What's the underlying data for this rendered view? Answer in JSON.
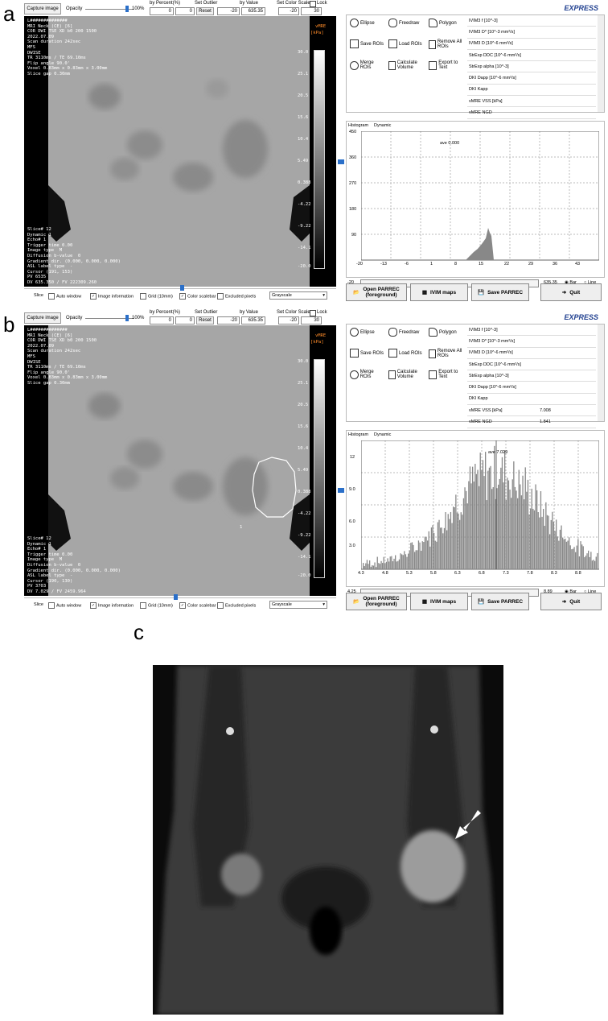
{
  "labels": {
    "a": "a",
    "b": "b",
    "c": "c"
  },
  "toolbar": {
    "capture": "Capture image",
    "opacity": "Opacity",
    "opacity_val": "100%",
    "by_percent": "by Percent(%)",
    "set_outlier": "Set Outlier",
    "by_value": "by Value",
    "set_color_scale": "Set Color Scale",
    "lock": "Lock",
    "reset": "Reset",
    "pct1": "0",
    "pct2": "0",
    "val1": "-20",
    "val2": "635.35",
    "cs1": "-20",
    "cs2": "30"
  },
  "overlay_a": {
    "info": "L##############\nMRI Neck (CE) [6]\nCOR DWI TSE XD b0 200 1500\n2022.07.09\nScan duration 242sec\nMFS\nDWISE\nTR 3110ms / TE 69.10ms\nFlip angle 90.0'\nVoxel 0.83mm x 0.83mm x 3.00mm\nSlice gap 0.30mm",
    "bottom": "Slice# 12\nDynamic 1\nEcho# 1\nTrigger time 0.00\nImage type  M\nDiffusion b-value  0\nGradient dir. (0.000, 0.000, 0.000)\nASL label type  -\nCursor (191, 153)\nPV 6535\nDV 635.350 / FV 222309.260",
    "vmre": "vMRE",
    "unit": "[kPa]"
  },
  "overlay_b": {
    "info": "L##############\nMRI Neck (CE) [6]\nCOR DWI TSE XD b0 200 1500\n2022.07.09\nScan duration 242sec\nMFS\nDWISE\nTR 3110ms / TE 69.10ms\nFlip angle 90.0'\nVoxel 0.83mm x 0.83mm x 3.00mm\nSlice gap 0.30mm",
    "bottom": "Slice# 12\nDynamic 1\nEcho# 1\nTrigger time 0.00\nImage type  M\nDiffusion b-value  0\nGradient dir. (0.000, 0.000, 0.000)\nASL label type  -\nCursor (190, 130)\nPV 3703\nDV 7.029 / FV 2459.964",
    "vmre": "vMRE",
    "unit": "[kPa]",
    "roi_label": "1"
  },
  "colorbar_ticks": [
    "30.0",
    "25.1",
    "20.5",
    "15.6",
    "10.4",
    "5.49",
    "0.388",
    "-4.22",
    "-9.22",
    "-14.1",
    "-20.0"
  ],
  "bottombar": {
    "slice": "Slice",
    "auto_window": "Auto window",
    "image_info": "Image information",
    "grid": "Grid (10mm)",
    "color_scalebar": "Color scalebar",
    "excluded_pixels": "Excluded pixels",
    "mode": "Grayscale"
  },
  "roi": {
    "ellipse": "Ellipse",
    "freedraw": "Freedraw",
    "polygon": "Polygon",
    "save": "Save ROIs",
    "load": "Load ROIs",
    "remove": "Remove All ROIs",
    "merge": "Merge ROIs",
    "calc": "Calculate Volume",
    "export": "Export to Text"
  },
  "list_a": [
    "IVIM3 f [10^-3]",
    "IVIM3 D* [10^-3 mm²/s]",
    "IVIM3 D [10^-6 mm²/s]",
    "StrExp DDC [10^-6 mm²/s]",
    "StrExp alpha [10^-3]",
    "DKI Dapp [10^-6 mm²/s]",
    "DKI Kapp",
    "vMRE VSS [kPa]",
    "vMRE NGD"
  ],
  "list_b": [
    {
      "name": "IVIM3 f [10^-3]",
      "val": ""
    },
    {
      "name": "IVIM3 D* [10^-3 mm²/s]",
      "val": ""
    },
    {
      "name": "IVIM3 D [10^-6 mm²/s]",
      "val": ""
    },
    {
      "name": "StrExp DDC [10^-6 mm²/s]",
      "val": ""
    },
    {
      "name": "StrExp alpha [10^-3]",
      "val": ""
    },
    {
      "name": "DKI Dapp [10^-6 mm²/s]",
      "val": ""
    },
    {
      "name": "DKI Kapp",
      "val": ""
    },
    {
      "name": "vMRE VSS [kPa]",
      "val": "7.008"
    },
    {
      "name": "vMRE NGD",
      "val": "1.841"
    }
  ],
  "tabs": {
    "histogram": "Histogram",
    "dynamic": "Dynamic"
  },
  "hist_a": {
    "ave": "ave 0.000",
    "yticks": [
      "450",
      "360",
      "270",
      "180",
      "90"
    ],
    "xticks": [
      "-20",
      "-13",
      "-6",
      "1",
      "8",
      "15",
      "22",
      "29",
      "36",
      "43"
    ],
    "min": "-20",
    "max": "635.35"
  },
  "hist_b": {
    "ave": "ave 7.029",
    "yticks": [
      "12",
      "9.0",
      "6.0",
      "3.0"
    ],
    "xticks": [
      "4.3",
      "4.8",
      "5.3",
      "5.8",
      "6.3",
      "6.8",
      "7.3",
      "7.8",
      "8.3",
      "8.8"
    ],
    "min": "4.25",
    "max": "8.89"
  },
  "radio": {
    "bar": "Bar",
    "line": "Line"
  },
  "buttons": {
    "open": "Open PARREC\n(foreground)",
    "ivim": "IVIM maps",
    "save": "Save PARREC",
    "quit": "Quit"
  },
  "brand": "EXPRESS"
}
